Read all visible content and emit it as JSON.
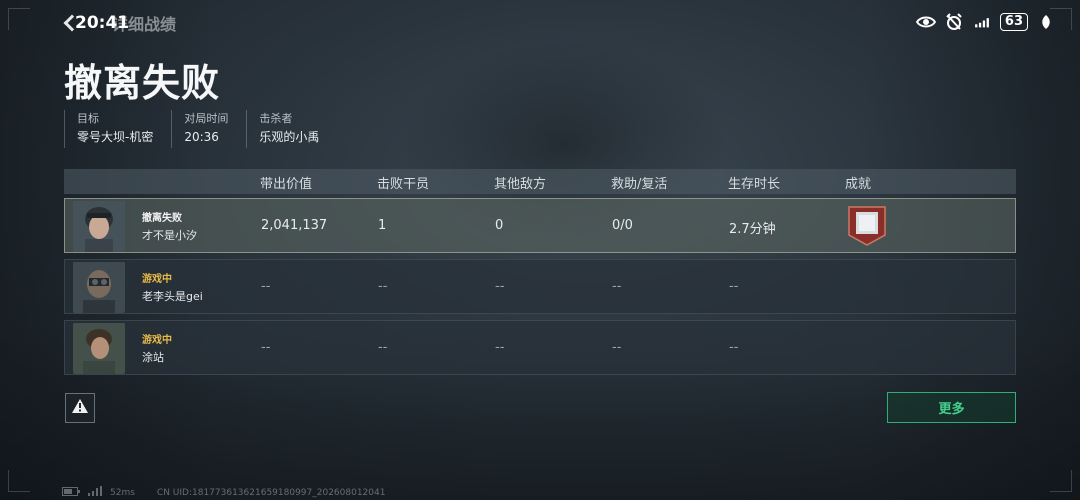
{
  "status_bar": {
    "time": "20:41",
    "battery": "63"
  },
  "header": {
    "back_label": "详细战绩",
    "title": "撤离失败"
  },
  "info": [
    {
      "label": "目标",
      "value": "零号大坝-机密"
    },
    {
      "label": "对局时间",
      "value": "20:36"
    },
    {
      "label": "击杀者",
      "value": "乐观的小禹"
    }
  ],
  "table": {
    "columns": [
      "带出价值",
      "击败干员",
      "其他敌方",
      "救助/复活",
      "生存时长",
      "成就"
    ],
    "rows": [
      {
        "state": "撤离失败",
        "name": "才不是小汐",
        "values": [
          "2,041,137",
          "1",
          "0",
          "0/0",
          "2.7分钟"
        ],
        "has_medal": true
      },
      {
        "state": "游戏中",
        "name": "老李头是gei",
        "values": [
          "--",
          "--",
          "--",
          "--",
          "--"
        ],
        "has_medal": false
      },
      {
        "state": "游戏中",
        "name": "涂站",
        "values": [
          "--",
          "--",
          "--",
          "--",
          "--"
        ],
        "has_medal": false
      }
    ]
  },
  "buttons": {
    "more": "更多"
  },
  "footer": {
    "ping": "52ms",
    "uid": "CN UID:1817736136216591809​97_202608012041"
  },
  "colors": {
    "accent_green": "#2fae78",
    "playing_gold": "#e7b94a"
  }
}
